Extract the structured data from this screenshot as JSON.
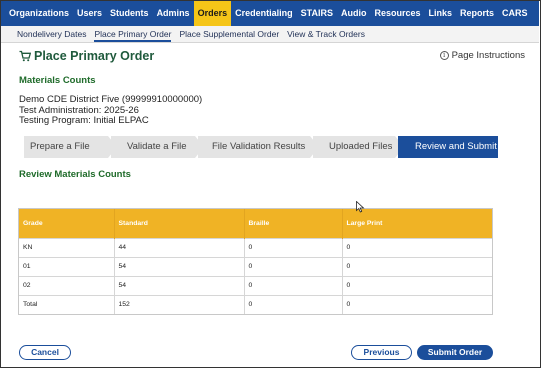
{
  "top_nav": {
    "items": [
      {
        "label": "Organizations"
      },
      {
        "label": "Users"
      },
      {
        "label": "Students"
      },
      {
        "label": "Admins"
      },
      {
        "label": "Orders",
        "active": true
      },
      {
        "label": "Credentialing"
      },
      {
        "label": "STAIRS"
      },
      {
        "label": "Audio"
      },
      {
        "label": "Resources"
      },
      {
        "label": "Links"
      },
      {
        "label": "Reports"
      },
      {
        "label": "CARS"
      }
    ]
  },
  "sub_nav": {
    "items": [
      {
        "label": "Nondelivery Dates"
      },
      {
        "label": "Place Primary Order",
        "active": true
      },
      {
        "label": "Place Supplemental Order"
      },
      {
        "label": "View & Track Orders"
      }
    ]
  },
  "page": {
    "title": "Place Primary Order",
    "title_icon": "cart-icon",
    "instructions_label": "Page Instructions",
    "instructions_icon": "info-icon"
  },
  "materials": {
    "heading": "Materials Counts",
    "district": "Demo CDE District Five (99999910000000)",
    "administration": "Test Administration: 2025-26",
    "program": "Testing Program: Initial ELPAC"
  },
  "steps": [
    {
      "label": "Prepare a File"
    },
    {
      "label": "Validate a File"
    },
    {
      "label": "File Validation Results"
    },
    {
      "label": "Uploaded Files"
    },
    {
      "label": "Review and Submit",
      "active": true
    }
  ],
  "review": {
    "heading": "Review Materials Counts",
    "columns": [
      "Grade",
      "Standard",
      "Braille",
      "Large Print"
    ],
    "rows": [
      {
        "grade": "KN",
        "standard": "44",
        "braille": "0",
        "large_print": "0"
      },
      {
        "grade": "01",
        "standard": "54",
        "braille": "0",
        "large_print": "0"
      },
      {
        "grade": "02",
        "standard": "54",
        "braille": "0",
        "large_print": "0"
      },
      {
        "grade": "Total",
        "standard": "152",
        "braille": "0",
        "large_print": "0"
      }
    ]
  },
  "buttons": {
    "cancel": "Cancel",
    "previous": "Previous",
    "submit": "Submit Order"
  },
  "colors": {
    "nav_bg": "#1b4e9b",
    "nav_active": "#f5c518",
    "table_header": "#f0b325",
    "heading_green": "#1f6b2a"
  }
}
